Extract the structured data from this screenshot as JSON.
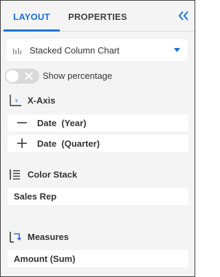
{
  "tabs": [
    {
      "label": "LAYOUT",
      "active": true
    },
    {
      "label": "PROPERTIES",
      "active": false
    }
  ],
  "collapse_icon": "double-chevron-left-icon",
  "chart_type": {
    "icon": "column-chart-icon",
    "label": "Stacked Column Chart",
    "caret_icon": "caret-down-icon"
  },
  "show_percentage": {
    "label": "Show percentage",
    "enabled": false
  },
  "sections": {
    "x_axis": {
      "title": "X-Axis",
      "icon": "x-axis-icon",
      "fields": [
        {
          "label": "Date  (Year)",
          "icon": "collapse-minus-icon"
        },
        {
          "label": "Date  (Quarter)",
          "icon": "expand-plus-icon"
        }
      ]
    },
    "color_stack": {
      "title": "Color Stack",
      "icon": "list-stack-icon",
      "field": "Sales Rep"
    },
    "measures": {
      "title": "Measures",
      "icon": "measures-icon",
      "field": "Amount (Sum)"
    }
  },
  "colors": {
    "accent": "#1a6fd6",
    "panel_bg": "#f4f4f4",
    "field_bg": "#ffffff",
    "text": "#333333"
  }
}
